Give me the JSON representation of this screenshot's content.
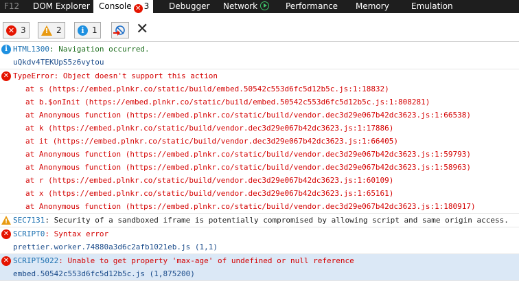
{
  "tabs": {
    "f12": "F12",
    "dom_explorer": "DOM Explorer",
    "console": "Console",
    "console_errors": "3",
    "debugger": "Debugger",
    "network": "Network",
    "performance": "Performance",
    "memory": "Memory",
    "emulation": "Emulation"
  },
  "toolbar": {
    "errors_count": "3",
    "warnings_count": "2",
    "info_count": "1"
  },
  "messages": [
    {
      "type": "info",
      "code": "HTML1300",
      "text": ": Navigation occurred.",
      "source": "uQkdv4TEKUpS5z6vytou"
    },
    {
      "type": "error",
      "text": "TypeError: Object doesn't support this action",
      "stack": [
        "at s (https://embed.plnkr.co/static/build/embed.50542c553d6fc5d12b5c.js:1:18832)",
        "at b.$onInit (https://embed.plnkr.co/static/build/embed.50542c553d6fc5d12b5c.js:1:808281)",
        "at Anonymous function (https://embed.plnkr.co/static/build/vendor.dec3d29e067b42dc3623.js:1:66538)",
        "at k (https://embed.plnkr.co/static/build/vendor.dec3d29e067b42dc3623.js:1:17886)",
        "at it (https://embed.plnkr.co/static/build/vendor.dec3d29e067b42dc3623.js:1:66405)",
        "at Anonymous function (https://embed.plnkr.co/static/build/vendor.dec3d29e067b42dc3623.js:1:59793)",
        "at Anonymous function (https://embed.plnkr.co/static/build/vendor.dec3d29e067b42dc3623.js:1:58963)",
        "at r (https://embed.plnkr.co/static/build/vendor.dec3d29e067b42dc3623.js:1:60109)",
        "at x (https://embed.plnkr.co/static/build/vendor.dec3d29e067b42dc3623.js:1:65161)",
        "at Anonymous function (https://embed.plnkr.co/static/build/vendor.dec3d29e067b42dc3623.js:1:180917)"
      ]
    },
    {
      "type": "warning",
      "code": "SEC7131",
      "text": ": Security of a sandboxed iframe is potentially compromised by allowing script and same origin access."
    },
    {
      "type": "error",
      "code": "SCRIPT0",
      "text": ": Syntax error",
      "source": "prettier.worker.74880a3d6c2afb1021eb.js (1,1)"
    },
    {
      "type": "error",
      "code": "SCRIPT5022",
      "text": ": Unable to get property 'max-age' of undefined or null reference",
      "source": "embed.50542c553d6fc5d12b5c.js (1,875200)"
    }
  ],
  "colors": {
    "error": "#e51400",
    "warning": "#e89a12",
    "info": "#1e90e0",
    "tabbar_bg": "#1e1e1e",
    "selected_row": "#dbe8f6"
  }
}
